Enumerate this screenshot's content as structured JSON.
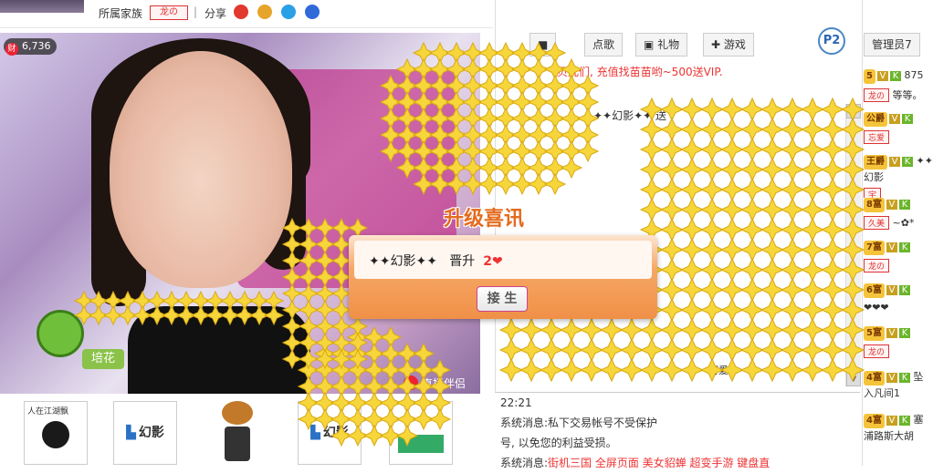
{
  "header": {
    "clan_label": "所属家族",
    "clan_badge": "龙の",
    "share_label": "分享",
    "separator": "|"
  },
  "video": {
    "viewer_icon": "财",
    "viewer_count": "6,736",
    "plant_label": "培花",
    "live_logo": "直播伴侣"
  },
  "bottom_tiles": [
    {
      "name": "tile-1",
      "label": "人在江湖飘"
    },
    {
      "name": "tile-2",
      "label": "幻影"
    },
    {
      "name": "tile-3",
      "label": ""
    },
    {
      "name": "tile-4",
      "label": "幻影"
    },
    {
      "name": "tile-5",
      "label": ""
    }
  ],
  "tabs": {
    "song": "点歌",
    "gift": "礼物",
    "game": "游戏",
    "p2": "P2",
    "admin": "管理员7"
  },
  "chat": {
    "vip_promo": "贝儿们, 充值找苗苗哟~500送VIP.",
    "gift_line": "✦✦幻影✦✦ 送",
    "cute_text": "可爱...",
    "time_line": "22:21",
    "sys_label": "系统消息:",
    "sys_msg_1": "私下交易帐号不受保护",
    "sys_msg_2": "号, 以免您的利益受损。",
    "sys_msg_3_links": "街机三国  全屏页面  美女貂蝉  超变手游  键盘直"
  },
  "popup": {
    "title": "升级喜讯",
    "message_name": "✦✦幻影✦✦",
    "message_action": "晋升",
    "message_level": "2",
    "confirm_label": "接 生"
  },
  "user_list": [
    {
      "level": "5",
      "name": "875",
      "family": "龙の",
      "extra": "等等。"
    },
    {
      "level": "公爵",
      "name": "",
      "family": "忘爱",
      "extra": ""
    },
    {
      "level": "王爵",
      "name": "✦✦幻影",
      "family": "宇",
      "extra": ""
    },
    {
      "level": "8富",
      "name": "",
      "family": "久美",
      "extra": "~✿*"
    },
    {
      "level": "7富",
      "name": "",
      "family": "龙の",
      "extra": ""
    },
    {
      "level": "6富",
      "name": "",
      "family": "",
      "extra": "❤❤❤"
    },
    {
      "level": "5富",
      "name": "",
      "family": "龙の",
      "extra": ""
    },
    {
      "level": "4富",
      "name": "坠入凡间1",
      "family": "",
      "extra": ""
    },
    {
      "level": "4富",
      "name": "塞浦路斯大胡",
      "family": "",
      "extra": ""
    }
  ],
  "colors": {
    "accent_orange": "#f09047",
    "star_yellow": "#f6d63a",
    "red": "#e33"
  }
}
